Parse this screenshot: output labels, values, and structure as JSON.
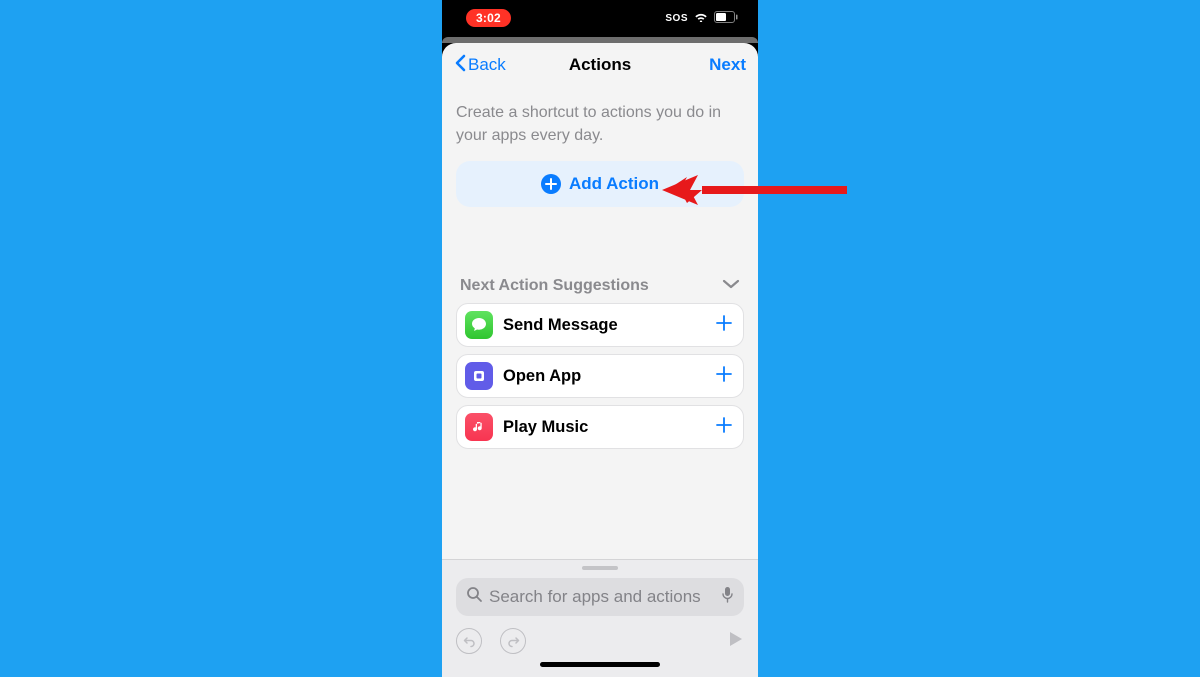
{
  "status": {
    "time": "3:02",
    "sos": "SOS"
  },
  "nav": {
    "back_label": "Back",
    "title": "Actions",
    "next_label": "Next"
  },
  "main": {
    "description": "Create a shortcut to actions you do in your apps every day.",
    "add_action_label": "Add Action"
  },
  "suggestions": {
    "header": "Next Action Suggestions",
    "items": [
      {
        "label": "Send Message",
        "icon": "messages-icon"
      },
      {
        "label": "Open App",
        "icon": "shortcuts-icon"
      },
      {
        "label": "Play Music",
        "icon": "music-icon"
      }
    ]
  },
  "search": {
    "placeholder": "Search for apps and actions"
  }
}
